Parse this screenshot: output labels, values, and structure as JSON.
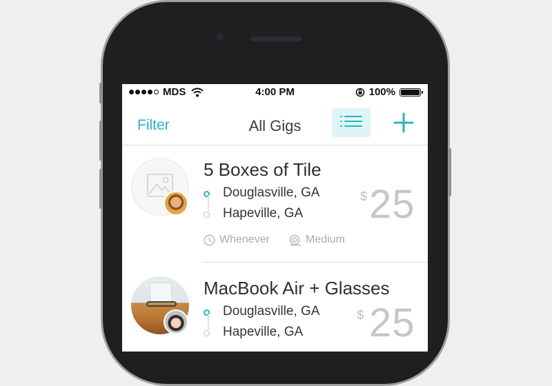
{
  "status_bar": {
    "carrier": "MDS",
    "time": "4:00 PM",
    "battery": "100%",
    "signal_bars_filled": 4,
    "signal_bars_total": 5
  },
  "nav": {
    "filter_label": "Filter",
    "title": "All Gigs",
    "list_icon": "list-icon",
    "add_icon": "plus-icon"
  },
  "gigs": [
    {
      "title": "5 Boxes of Tile",
      "origin": "Douglasville, GA",
      "destination": "Hapeville, GA",
      "currency": "$",
      "price": "25",
      "timing": "Whenever",
      "size": "Medium"
    },
    {
      "title": "MacBook Air + Glasses",
      "origin": "Douglasville, GA",
      "destination": "Hapeville, GA",
      "currency": "$",
      "price": "25"
    }
  ],
  "colors": {
    "accent": "#27b3c3",
    "accent_light": "#dff4f6",
    "muted": "#a7abad",
    "price": "#c2c8c8"
  }
}
